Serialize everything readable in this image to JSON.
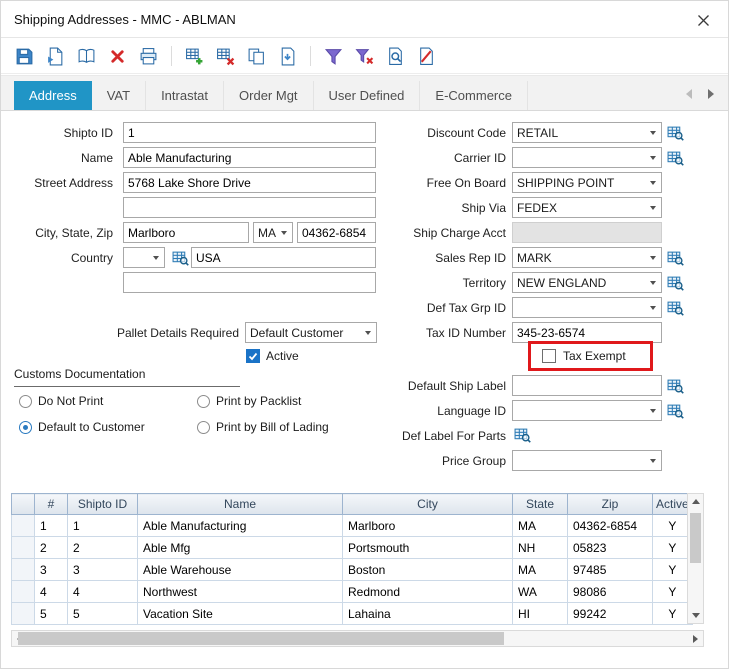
{
  "window": {
    "title": "Shipping Addresses - MMC - ABLMAN"
  },
  "toolbar": {
    "buttons": [
      {
        "name": "save-icon"
      },
      {
        "name": "new-document-icon"
      },
      {
        "name": "browse-book-icon"
      },
      {
        "name": "delete-icon"
      },
      {
        "name": "print-icon"
      },
      {
        "name": "table-add-icon"
      },
      {
        "name": "table-remove-icon"
      },
      {
        "name": "copy-icon"
      },
      {
        "name": "paste-document-icon"
      },
      {
        "name": "filter-icon"
      },
      {
        "name": "clear-filter-icon"
      },
      {
        "name": "find-document-icon"
      },
      {
        "name": "cancel-find-icon"
      }
    ]
  },
  "tabs": {
    "items": [
      {
        "label": "Address",
        "active": true
      },
      {
        "label": "VAT",
        "active": false
      },
      {
        "label": "Intrastat",
        "active": false
      },
      {
        "label": "Order Mgt",
        "active": false
      },
      {
        "label": "User Defined",
        "active": false
      },
      {
        "label": "E-Commerce",
        "active": false
      }
    ]
  },
  "form": {
    "left": {
      "shipto_id": {
        "label": "Shipto ID",
        "value": "1"
      },
      "name": {
        "label": "Name",
        "value": "Able Manufacturing"
      },
      "street_address": {
        "label": "Street Address",
        "line1": "5768 Lake Shore Drive",
        "line2": ""
      },
      "city_state_zip": {
        "label": "City, State, Zip",
        "city": "Marlboro",
        "state": "MA",
        "zip": "04362-6854"
      },
      "country": {
        "label": "Country",
        "code": "",
        "name": "USA",
        "line2": ""
      },
      "pallet_details": {
        "label": "Pallet Details Required",
        "value": "Default Customer"
      },
      "active": {
        "label": "Active",
        "checked": true
      },
      "customs": {
        "title": "Customs Documentation",
        "options": [
          {
            "label": "Do Not Print",
            "selected": false
          },
          {
            "label": "Print by Packlist",
            "selected": false
          },
          {
            "label": "Default to Customer",
            "selected": true
          },
          {
            "label": "Print by Bill of Lading",
            "selected": false
          }
        ]
      }
    },
    "right": {
      "discount_code": {
        "label": "Discount Code",
        "value": "RETAIL"
      },
      "carrier_id": {
        "label": "Carrier ID",
        "value": ""
      },
      "free_on_board": {
        "label": "Free On Board",
        "value": "SHIPPING POINT"
      },
      "ship_via": {
        "label": "Ship Via",
        "value": "FEDEX"
      },
      "ship_charge_acct": {
        "label": "Ship Charge Acct",
        "value": "",
        "disabled": true
      },
      "sales_rep_id": {
        "label": "Sales Rep ID",
        "value": "MARK"
      },
      "territory": {
        "label": "Territory",
        "value": "NEW ENGLAND"
      },
      "def_tax_grp_id": {
        "label": "Def Tax Grp ID",
        "value": ""
      },
      "tax_id_number": {
        "label": "Tax ID Number",
        "value": "345-23-6574"
      },
      "tax_exempt": {
        "label": "Tax Exempt",
        "checked": false,
        "highlighted": true
      },
      "default_ship_label": {
        "label": "Default Ship Label",
        "value": ""
      },
      "language_id": {
        "label": "Language ID",
        "value": ""
      },
      "def_label_for_parts": {
        "label": "Def Label For Parts"
      },
      "price_group": {
        "label": "Price Group",
        "value": ""
      }
    }
  },
  "grid": {
    "headers": [
      "#",
      "Shipto ID",
      "Name",
      "City",
      "State",
      "Zip",
      "Active"
    ],
    "rows": [
      {
        "num": "1",
        "shipto_id": "1",
        "name": "Able Manufacturing",
        "city": "Marlboro",
        "state": "MA",
        "zip": "04362-6854",
        "active": "Y"
      },
      {
        "num": "2",
        "shipto_id": "2",
        "name": "Able Mfg",
        "city": "Portsmouth",
        "state": "NH",
        "zip": "05823",
        "active": "Y"
      },
      {
        "num": "3",
        "shipto_id": "3",
        "name": "Able Warehouse",
        "city": "Boston",
        "state": "MA",
        "zip": "97485",
        "active": "Y"
      },
      {
        "num": "4",
        "shipto_id": "4",
        "name": "Northwest",
        "city": "Redmond",
        "state": "WA",
        "zip": "98086",
        "active": "Y"
      },
      {
        "num": "5",
        "shipto_id": "5",
        "name": "Vacation Site",
        "city": "Lahaina",
        "state": "HI",
        "zip": "99242",
        "active": "Y"
      }
    ]
  },
  "colors": {
    "active_tab": "#2095c6",
    "checkbox_checked": "#1a73c7",
    "annotation_highlight": "#e0181b",
    "grid_header_text": "#33475c"
  }
}
